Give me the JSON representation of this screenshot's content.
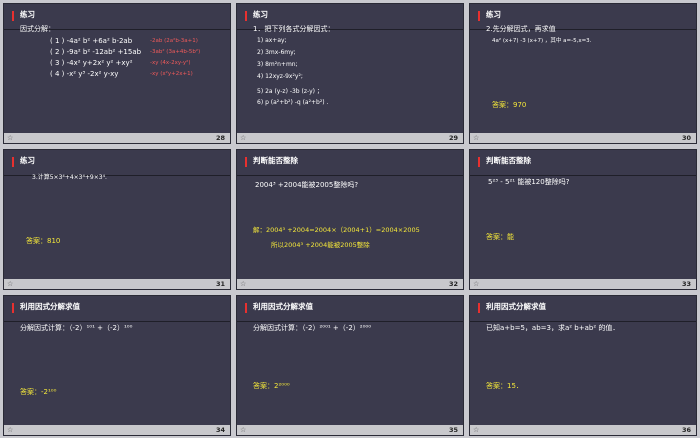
{
  "slides": [
    {
      "title": "练习",
      "page": "28",
      "heading": "因式分解：",
      "items": [
        {
          "text": "( 1 ) -4a² b² +6a² b-2ab",
          "answer": "-2ab (2a²b-3a+1)"
        },
        {
          "text": "( 2 ) -9a² b² -12ab² +15ab",
          "answer": "-3ab² (3a+4b-5b²)"
        },
        {
          "text": "( 3 ) -4x² y+2x² y² +xy²",
          "answer": "-xy (4x-2xy-y²)"
        },
        {
          "text": "( 4 ) -x² y³ -2x² y-xy",
          "answer": "-xy (x²y+2x+1)"
        }
      ]
    },
    {
      "title": "练习",
      "page": "29",
      "heading": "1．把下列各式分解因式：",
      "items": [
        "1) ax+ay;",
        "2) 3mx-6my;",
        "3) 8m²n+mn;",
        "4) 12xyz-9x²y²;",
        "5) 2a (y-z) -3b (z-y) ；",
        "6) p (a²+b²) -q (a²+b²) ."
      ]
    },
    {
      "title": "练习",
      "page": "30",
      "heading": "2.先分解因式，再求值",
      "problem": "4a² (x+7) -3 (x+7) ，其中 a=-5,x=3.",
      "answer": "答案：970"
    },
    {
      "title": "练习",
      "page": "31",
      "heading": "3.计算5×3⁴+4×3⁴+9×3⁴.",
      "answer": "答案：810"
    },
    {
      "title": "判断能否整除",
      "page": "32",
      "question": "2004³ +2004能被2005整除吗?",
      "solution_line1": "解：2004³ +2004=2004×（2004+1）=2004×2005",
      "solution_line2": "所以2004³ +2004能被2005整除"
    },
    {
      "title": "判断能否整除",
      "page": "33",
      "question": "5²³ - 5²¹ 能被120整除吗?",
      "answer": "答案：能"
    },
    {
      "title": "利用因式分解求值",
      "page": "34",
      "question": "分解因式计算：（-2）¹⁰¹ +（-2）¹⁰⁰",
      "answer": "答案：-2¹⁰⁰"
    },
    {
      "title": "利用因式分解求值",
      "page": "35",
      "question": "分解因式计算：（-2）²⁰⁰¹ +（-2）²⁰⁰⁰",
      "answer": "答案：2²⁰⁰⁰"
    },
    {
      "title": "利用因式分解求值",
      "page": "36",
      "question": "已知a+b=5，ab=3，求a² b+ab² 的值．",
      "answer": "答案：15．"
    }
  ],
  "icons": {
    "footer": "star-icon"
  },
  "colors": {
    "slide_bg": "#3b3a4d",
    "accent": "#e8302f",
    "answer": "#f5e83a",
    "red_answer": "#ef5a5a"
  }
}
